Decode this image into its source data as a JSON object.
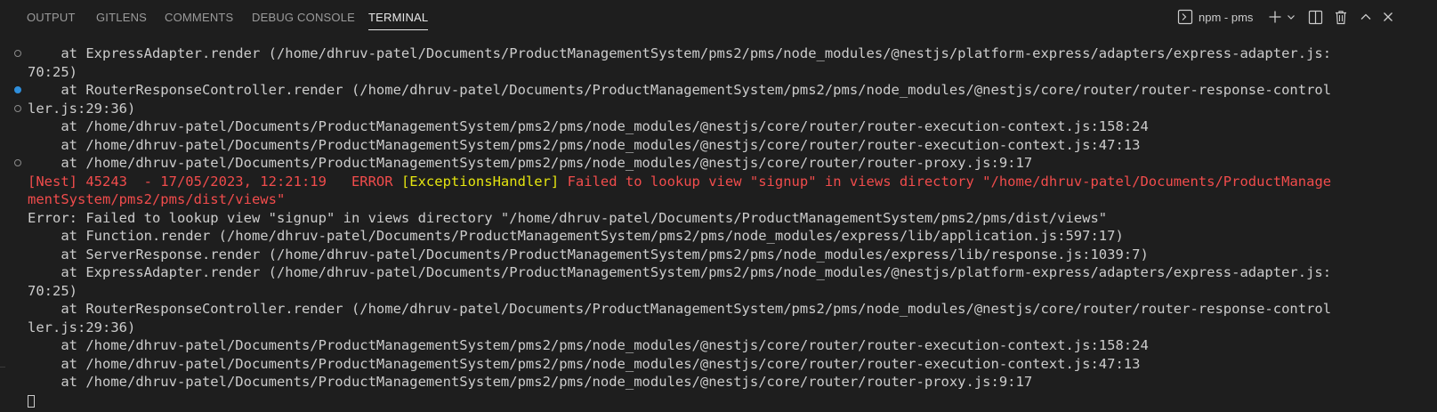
{
  "tabs": [
    {
      "label": "OUTPUT"
    },
    {
      "label": "GITLENS"
    },
    {
      "label": "COMMENTS"
    },
    {
      "label": "DEBUG CONSOLE"
    },
    {
      "label": "TERMINAL",
      "active": true
    }
  ],
  "actions": {
    "profile_label": "npm - pms",
    "icons": [
      "terminal-icon",
      "add-icon",
      "chevron-down-icon",
      "split-icon",
      "trash-icon",
      "chevron-up-icon",
      "close-icon"
    ]
  },
  "colors": {
    "background": "#1e1e1e",
    "text": "#cccccc",
    "error_red": "#f14c4c",
    "warning_yellow": "#e5e510",
    "decoration_blue": "#2f8fdc"
  },
  "terminal": {
    "lines": [
      "    at ExpressAdapter.render (/home/dhruv-patel/Documents/ProductManagementSystem/pms2/pms/node_modules/@nestjs/platform-express/adapters/express-adapter.js:",
      "70:25)",
      "    at RouterResponseController.render (/home/dhruv-patel/Documents/ProductManagementSystem/pms2/pms/node_modules/@nestjs/core/router/router-response-control",
      "ler.js:29:36)",
      "    at /home/dhruv-patel/Documents/ProductManagementSystem/pms2/pms/node_modules/@nestjs/core/router/router-execution-context.js:158:24",
      "    at /home/dhruv-patel/Documents/ProductManagementSystem/pms2/pms/node_modules/@nestjs/core/router/router-execution-context.js:47:13",
      "    at /home/dhruv-patel/Documents/ProductManagementSystem/pms2/pms/node_modules/@nestjs/core/router/router-proxy.js:9:17",
      "",
      "",
      "Error: Failed to lookup view \"signup\" in views directory \"/home/dhruv-patel/Documents/ProductManagementSystem/pms2/pms/dist/views\"",
      "    at Function.render (/home/dhruv-patel/Documents/ProductManagementSystem/pms2/pms/node_modules/express/lib/application.js:597:17)",
      "    at ServerResponse.render (/home/dhruv-patel/Documents/ProductManagementSystem/pms2/pms/node_modules/express/lib/response.js:1039:7)",
      "    at ExpressAdapter.render (/home/dhruv-patel/Documents/ProductManagementSystem/pms2/pms/node_modules/@nestjs/platform-express/adapters/express-adapter.js:",
      "70:25)",
      "    at RouterResponseController.render (/home/dhruv-patel/Documents/ProductManagementSystem/pms2/pms/node_modules/@nestjs/core/router/router-response-control",
      "ler.js:29:36)",
      "    at /home/dhruv-patel/Documents/ProductManagementSystem/pms2/pms/node_modules/@nestjs/core/router/router-execution-context.js:158:24",
      "    at /home/dhruv-patel/Documents/ProductManagementSystem/pms2/pms/node_modules/@nestjs/core/router/router-execution-context.js:47:13",
      "    at /home/dhruv-patel/Documents/ProductManagementSystem/pms2/pms/node_modules/@nestjs/core/router/router-proxy.js:9:17"
    ],
    "nest_error": {
      "prefix": "[Nest] 45243  - 17/05/2023, 12:21:19   ERROR ",
      "context": "[ExceptionsHandler]",
      "message_part1": " Failed to lookup view \"signup\" in views directory \"/home/dhruv-patel/Documents/ProductManage",
      "message_part2": "mentSystem/pms2/pms/dist/views\""
    }
  }
}
